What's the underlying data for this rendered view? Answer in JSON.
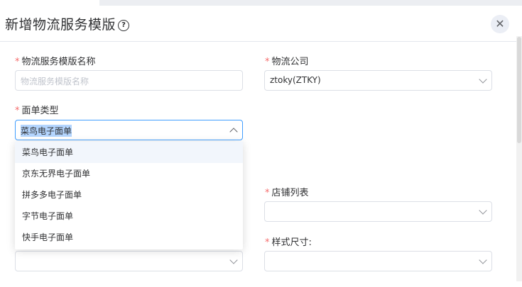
{
  "dialog": {
    "title": "新增物流服务模版",
    "help_icon": "question-circle-icon",
    "close_icon": "close-icon",
    "help_glyph": "?",
    "close_glyph": "✕"
  },
  "form": {
    "required_mark": "*",
    "template_name": {
      "label": "物流服务模版名称",
      "placeholder": "物流服务模版名称",
      "value": ""
    },
    "logistics_company": {
      "label": "物流公司",
      "value": "ztoky(ZTKY)"
    },
    "waybill_type": {
      "label": "面单类型",
      "value": "菜鸟电子面单"
    },
    "shop_list": {
      "label": "店铺列表",
      "value": ""
    },
    "style_size": {
      "label": "样式尺寸:",
      "value": ""
    },
    "left_bottom_select": {
      "value": ""
    }
  },
  "waybill_dropdown": {
    "options": [
      "菜鸟电子面单",
      "京东无界电子面单",
      "拼多多电子面单",
      "字节电子面单",
      "快手电子面单"
    ],
    "selected_index": 0
  }
}
